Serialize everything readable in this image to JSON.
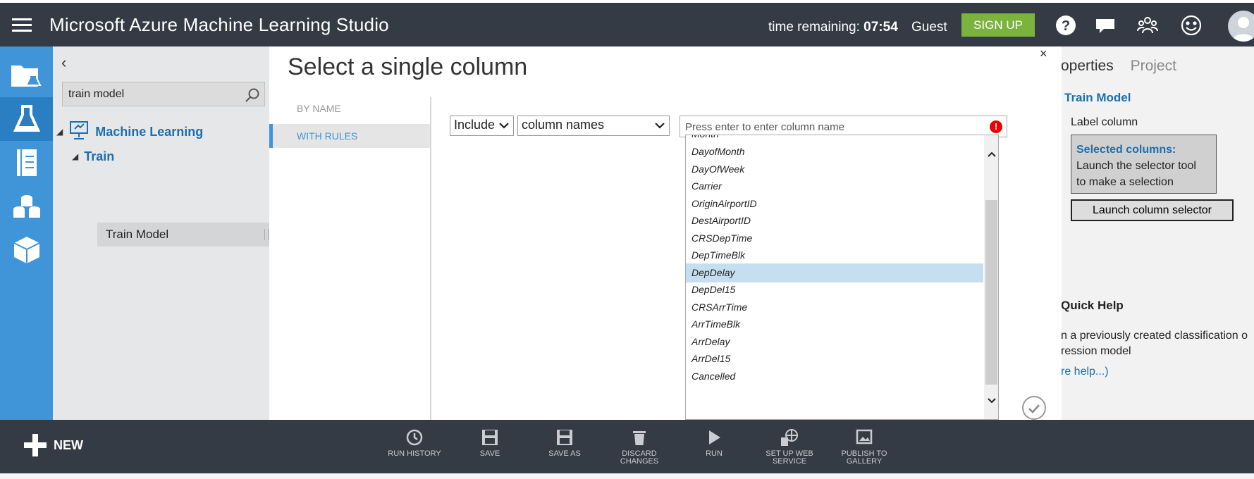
{
  "header": {
    "title": "Microsoft Azure Machine Learning Studio",
    "time_label": "time remaining:",
    "time_value": "07:54",
    "user": "Guest",
    "signup": "SIGN UP"
  },
  "sidebar": {
    "search_value": "train model",
    "tree": {
      "root": "Machine Learning",
      "child": "Train",
      "leaf": "Train Model"
    }
  },
  "modal": {
    "title": "Select a single column",
    "close": "×",
    "tabs": {
      "by_name": "BY NAME",
      "with_rules": "WITH RULES"
    },
    "include_value": "Include",
    "rule_value": "column names",
    "column_placeholder": "Press enter to enter column name",
    "column_options": [
      "Month",
      "DayofMonth",
      "DayOfWeek",
      "Carrier",
      "OriginAirportID",
      "DestAirportID",
      "CRSDepTime",
      "DepTimeBlk",
      "DepDelay",
      "DepDel15",
      "CRSArrTime",
      "ArrTimeBlk",
      "ArrDelay",
      "ArrDel15",
      "Cancelled"
    ],
    "selected_option": "DepDelay"
  },
  "properties": {
    "tab_properties": "operties",
    "tab_project": "Project",
    "module": "Train Model",
    "label_column": "Label column",
    "selected_title": "Selected columns:",
    "selected_text_1": "Launch the selector tool",
    "selected_text_2": "to make a selection",
    "launch": "Launch column selector",
    "quick_help": "Quick Help",
    "help_line_1": "n a previously created classification o",
    "help_line_2": "ression model",
    "help_link": "re help...)"
  },
  "toolbar": {
    "new": "NEW",
    "commands": [
      {
        "label": "RUN HISTORY",
        "icon": "clock-icon"
      },
      {
        "label": "SAVE",
        "icon": "save-icon"
      },
      {
        "label": "SAVE AS",
        "icon": "save-as-icon"
      },
      {
        "label": "DISCARD CHANGES",
        "icon": "trash-icon"
      },
      {
        "label": "RUN",
        "icon": "play-icon"
      },
      {
        "label": "SET UP WEB",
        "label2": "SERVICE",
        "icon": "web-service-icon"
      },
      {
        "label": "PUBLISH TO",
        "label2": "GALLERY",
        "icon": "gallery-icon"
      }
    ]
  },
  "colors": {
    "topbar": "#343b45",
    "rail": "#3f95d8",
    "accent": "#3f95d8",
    "signup": "#7ab43f",
    "selected_row": "#c5dff0"
  }
}
